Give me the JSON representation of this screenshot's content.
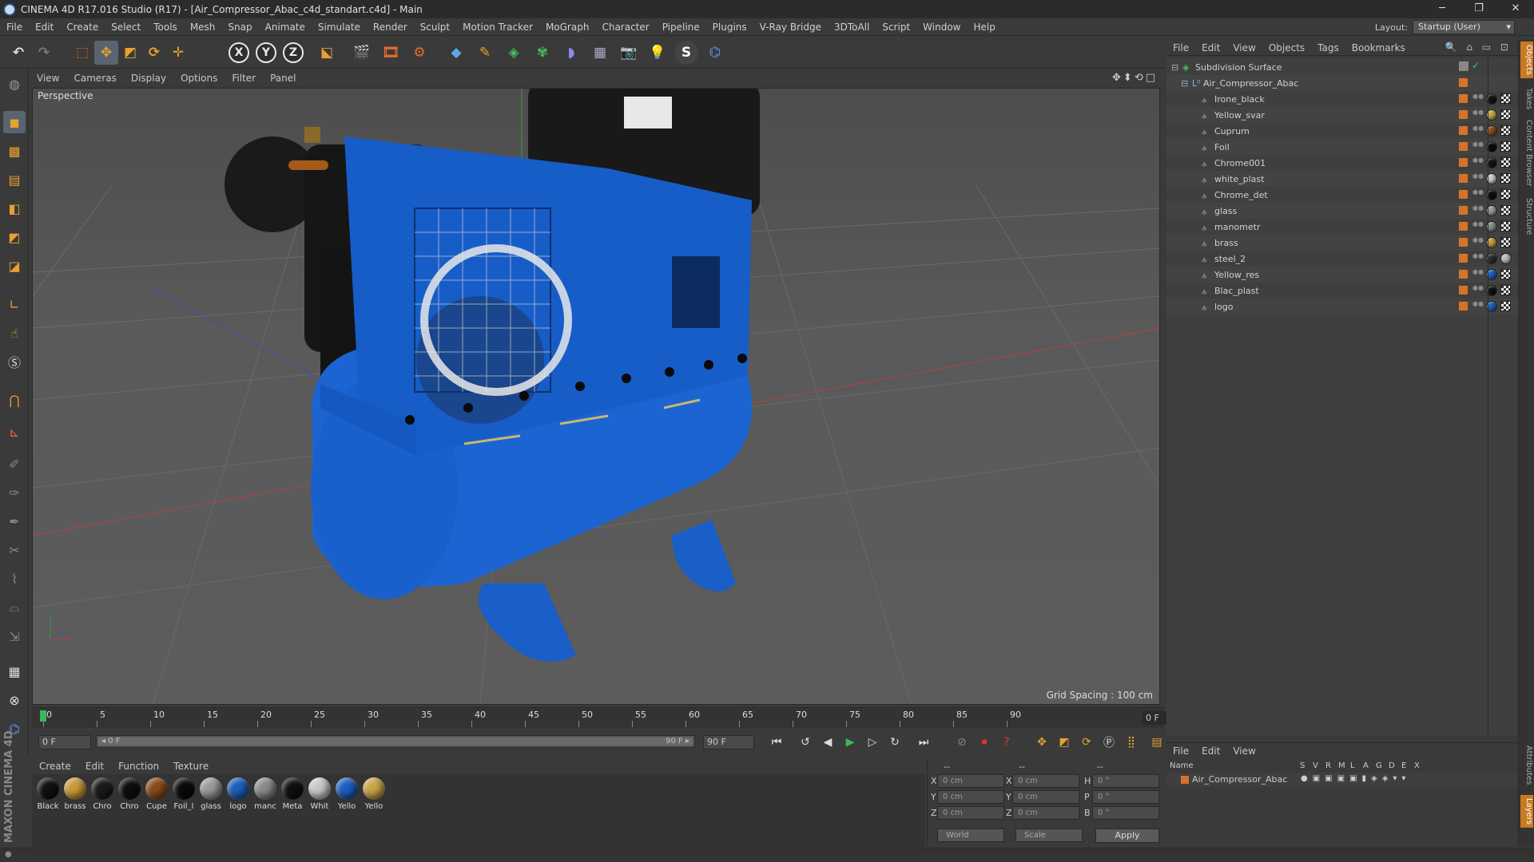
{
  "window": {
    "title": "CINEMA 4D R17.016 Studio (R17) - [Air_Compressor_Abac_c4d_standart.c4d] - Main",
    "minimize": "─",
    "restore": "❐",
    "close": "✕"
  },
  "menu": [
    "File",
    "Edit",
    "Create",
    "Select",
    "Tools",
    "Mesh",
    "Snap",
    "Animate",
    "Simulate",
    "Render",
    "Sculpt",
    "Motion Tracker",
    "MoGraph",
    "Character",
    "Pipeline",
    "Plugins",
    "V-Ray Bridge",
    "3DToAll",
    "Script",
    "Window",
    "Help"
  ],
  "layout": {
    "label": "Layout:",
    "value": "Startup (User)"
  },
  "toolbar": {
    "x_axis": "X",
    "y_axis": "Y",
    "z_axis": "Z"
  },
  "viewport": {
    "menu": [
      "View",
      "Cameras",
      "Display",
      "Options",
      "Filter",
      "Panel"
    ],
    "label": "Perspective",
    "grid_spacing": "Grid Spacing : 100 cm",
    "nav_icons": "✥⬍⟲□"
  },
  "timeline": {
    "ticks": [
      "0",
      "5",
      "10",
      "15",
      "20",
      "25",
      "30",
      "35",
      "40",
      "45",
      "50",
      "55",
      "60",
      "65",
      "70",
      "75",
      "80",
      "85",
      "90"
    ],
    "current_frame": "0 F"
  },
  "transport": {
    "start_field": "0 F",
    "range_start": "◂ 0 F",
    "range_end": "90 F ▸",
    "end_field": "90 F"
  },
  "material_manager": {
    "menu": [
      "Create",
      "Edit",
      "Function",
      "Texture"
    ],
    "materials": [
      {
        "label": "Black",
        "color": "#111111"
      },
      {
        "label": "brass",
        "color": "#c99a3a"
      },
      {
        "label": "Chro",
        "color": "#1a1a1a"
      },
      {
        "label": "Chro",
        "color": "#0d0d0d"
      },
      {
        "label": "Cupe",
        "color": "#8a4a1a"
      },
      {
        "label": "Foil_I",
        "color": "#0a0a0a"
      },
      {
        "label": "glass",
        "color": "#9a9a9a"
      },
      {
        "label": "logo",
        "color": "#1d5fb8"
      },
      {
        "label": "manc",
        "color": "#8a8a8a"
      },
      {
        "label": "Meta",
        "color": "#101010"
      },
      {
        "label": "Whit",
        "color": "#c8c8c8"
      },
      {
        "label": "Yello",
        "color": "#1d5fc0"
      },
      {
        "label": "Yello",
        "color": "#c9a548"
      }
    ]
  },
  "coordinates": {
    "header_a": "--",
    "header_b": "--",
    "header_c": "--",
    "rows": [
      {
        "axis": "X",
        "pos": "0 cm",
        "axis2": "X",
        "size": "0 cm",
        "rot_axis": "H",
        "rot": "0 °"
      },
      {
        "axis": "Y",
        "pos": "0 cm",
        "axis2": "Y",
        "size": "0 cm",
        "rot_axis": "P",
        "rot": "0 °"
      },
      {
        "axis": "Z",
        "pos": "0 cm",
        "axis2": "Z",
        "size": "0 cm",
        "rot_axis": "B",
        "rot": "0 °"
      }
    ],
    "mode": "World",
    "scale": "Scale",
    "apply": "Apply"
  },
  "object_manager": {
    "menu": [
      "File",
      "Edit",
      "View",
      "Objects",
      "Tags",
      "Bookmarks"
    ],
    "root": "Subdivision Surface",
    "group": "Air_Compressor_Abac",
    "objects": [
      {
        "name": "Irone_black",
        "mat": "#111111"
      },
      {
        "name": "Yellow_svar",
        "mat": "#c9a548"
      },
      {
        "name": "Cuprum",
        "mat": "#8a4a1a"
      },
      {
        "name": "Foil",
        "mat": "#0a0a0a"
      },
      {
        "name": "Chrome001",
        "mat": "#111111"
      },
      {
        "name": "white_plast",
        "mat": "#c8c8c8"
      },
      {
        "name": "Chrome_det",
        "mat": "#0d0d0d"
      },
      {
        "name": "glass",
        "mat": "#9a9a9a"
      },
      {
        "name": "manometr",
        "mat": "#8a8a8a"
      },
      {
        "name": "brass",
        "mat": "#c99a3a"
      },
      {
        "name": "steel_2",
        "mat": "#2a2a2a"
      },
      {
        "name": "Yellow_res",
        "mat": "#1d5fc0"
      },
      {
        "name": "Blac_plast",
        "mat": "#101010"
      },
      {
        "name": "logo",
        "mat": "#1d5fb8"
      }
    ]
  },
  "attribute_manager": {
    "menu": [
      "File",
      "Edit",
      "View"
    ],
    "columns": [
      "Name",
      "S",
      "V",
      "R",
      "M",
      "L",
      "A",
      "G",
      "D",
      "E",
      "X"
    ],
    "row_name": "Air_Compressor_Abac"
  },
  "side_tabs": [
    "Objects",
    "Takes",
    "Content Browser",
    "Structure"
  ],
  "side_tabs_bottom": [
    "Attributes",
    "Layers"
  ],
  "brand": "MAXON CINEMA 4D"
}
